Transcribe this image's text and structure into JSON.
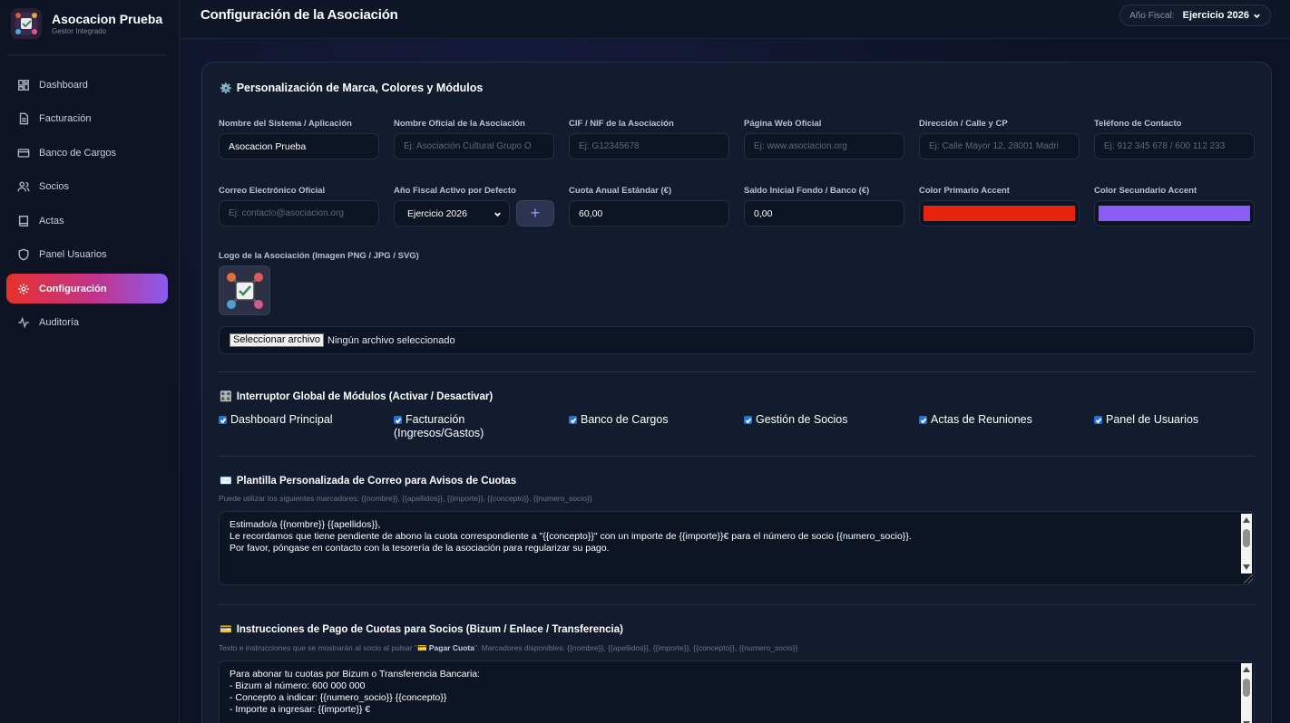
{
  "brand": {
    "title": "Asocacion Prueba",
    "subtitle": "Gestor Integrado"
  },
  "sidebar": {
    "items": [
      {
        "label": "Dashboard",
        "icon": "dashboard-icon"
      },
      {
        "label": "Facturación",
        "icon": "file-icon"
      },
      {
        "label": "Banco de Cargos",
        "icon": "card-icon"
      },
      {
        "label": "Socios",
        "icon": "users-icon"
      },
      {
        "label": "Actas",
        "icon": "book-icon"
      },
      {
        "label": "Panel Usuarios",
        "icon": "shield-icon"
      },
      {
        "label": "Configuración",
        "icon": "gear-icon",
        "active": true
      },
      {
        "label": "Auditoría",
        "icon": "activity-icon"
      }
    ]
  },
  "header": {
    "title": "Configuración de la Asociación",
    "fiscal_label": "Año Fiscal:",
    "fiscal_value": "Ejercicio 2026"
  },
  "branding": {
    "title": "Personalización de Marca, Colores y Módulos",
    "fields": {
      "system_name": {
        "label": "Nombre del Sistema / Aplicación",
        "value": "Asocacion Prueba"
      },
      "official_name": {
        "label": "Nombre Oficial de la Asociación",
        "placeholder": "Ej: Asociación Cultural Grupo O"
      },
      "cif": {
        "label": "CIF / NIF de la Asociación",
        "placeholder": "Ej: G12345678"
      },
      "website": {
        "label": "Página Web Oficial",
        "placeholder": "Ej: www.asociacion.org"
      },
      "address": {
        "label": "Dirección / Calle y CP",
        "placeholder": "Ej: Calle Mayor 12, 28001 Madri"
      },
      "phone": {
        "label": "Teléfono de Contacto",
        "placeholder": "Ej: 912 345 678 / 600 112 233"
      },
      "email": {
        "label": "Correo Electrónico Oficial",
        "placeholder": "Ej: contacto@asociacion.org"
      },
      "fiscal_year": {
        "label": "Año Fiscal Activo por Defecto",
        "value": "Ejercicio 2026",
        "add_label": "+"
      },
      "annual_fee": {
        "label": "Cuota Anual Estándar (€)",
        "value": "60,00"
      },
      "initial_balance": {
        "label": "Saldo Inicial Fondo / Banco (€)",
        "value": "0,00"
      },
      "primary_color": {
        "label": "Color Primario Accent",
        "value": "#e8230d"
      },
      "secondary_color": {
        "label": "Color Secundario Accent",
        "value": "#8b5cf6"
      },
      "logo": {
        "label": "Logo de la Asociación (Imagen PNG / JPG / SVG)"
      },
      "file": {
        "button": "Seleccionar archivo",
        "status": "Ningún archivo seleccionado"
      }
    }
  },
  "modules": {
    "title": "Interruptor Global de Módulos (Activar / Desactivar)",
    "items": [
      {
        "label": "Dashboard Principal",
        "checked": true
      },
      {
        "label": "Facturación",
        "label2": "(Ingresos/Gastos)",
        "checked": true
      },
      {
        "label": "Banco de Cargos",
        "checked": true
      },
      {
        "label": "Gestión de Socios",
        "checked": true
      },
      {
        "label": "Actas de Reuniones",
        "checked": true
      },
      {
        "label": "Panel de Usuarios",
        "checked": true
      }
    ]
  },
  "email_template": {
    "title": "Plantilla Personalizada de Correo para Avisos de Cuotas",
    "hint": "Puede utilizar los siguientes marcadores: {{nombre}}, {{apellidos}}, {{importe}}, {{concepto}}, {{numero_socio}}",
    "lines": [
      "Estimado/a {{nombre}} {{apellidos}},",
      "",
      "Le recordamos que tiene pendiente de abono la cuota correspondiente a \"{{concepto}}\" con un importe de {{importe}}€ para el número de socio {{numero_socio}}.",
      "",
      "Por favor, póngase en contacto con la tesorería de la asociación para regularizar su pago."
    ]
  },
  "payment": {
    "title": "Instrucciones de Pago de Cuotas para Socios (Bizum / Enlace / Transferencia)",
    "hint_pre": "Texto e instrucciones que se mostrarán al socio al pulsar \"",
    "hint_button": "💳 Pagar Cuota",
    "hint_post": "\". Marcadores disponibles: {{nombre}}, {{apellidos}}, {{importe}}, {{concepto}}, {{numero_socio}}",
    "lines": [
      "Para abonar tu cuotas por Bizum o Transferencia Bancaria:",
      "",
      "- Bizum al número: 600 000 000",
      "- Concepto a indicar: {{numero_socio}} {{concepto}}",
      "- Importe a ingresar: {{importe}} €"
    ]
  }
}
